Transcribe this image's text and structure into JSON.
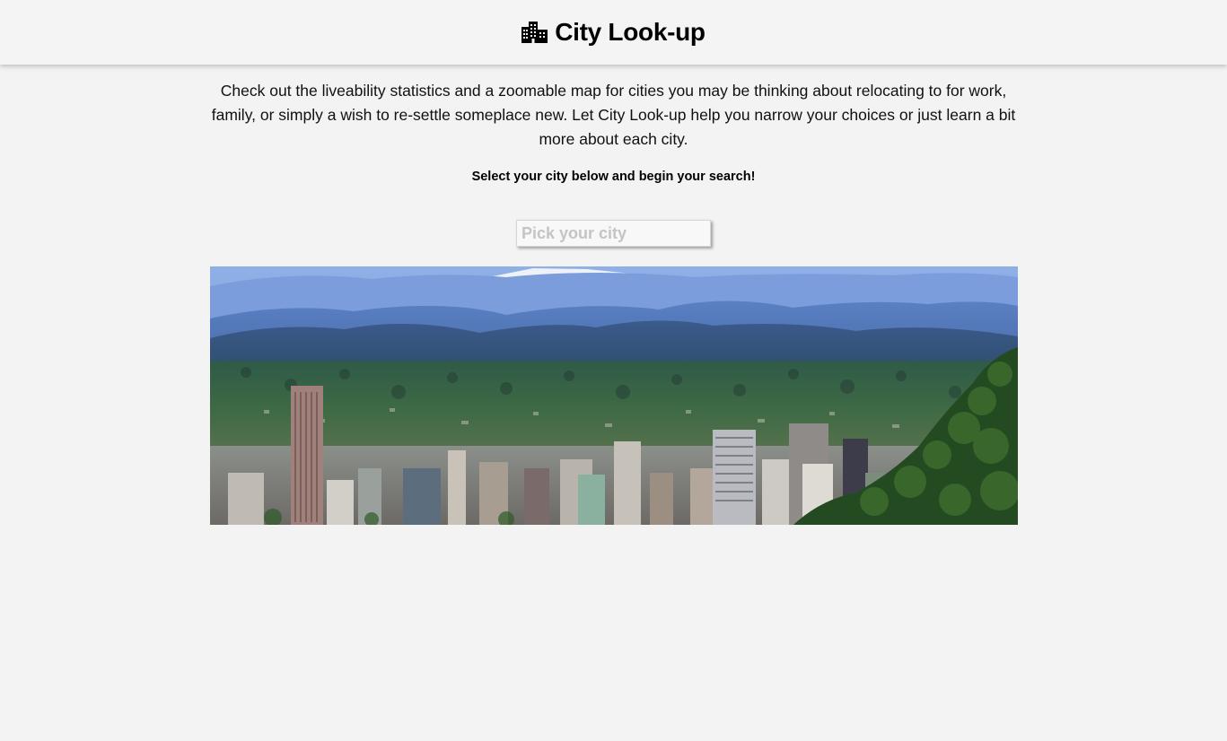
{
  "header": {
    "icon": "city-buildings-icon",
    "title": "City Look-up"
  },
  "main": {
    "intro": "Check out the liveability statistics and a zoomable map for cities you may be thinking about relocating to for work, family, or simply a wish to re-settle someplace new. Let City Look-up help you narrow your choices or just learn a bit more about each city.",
    "cta": "Select your city below and begin your search!",
    "search": {
      "placeholder": "Pick your city",
      "value": ""
    },
    "hero_image": "city-skyline-photo"
  },
  "colors": {
    "background": "#f3f3f3",
    "header_bg": "#f4f4f4",
    "text": "#111111",
    "placeholder": "#c4c4c4"
  }
}
